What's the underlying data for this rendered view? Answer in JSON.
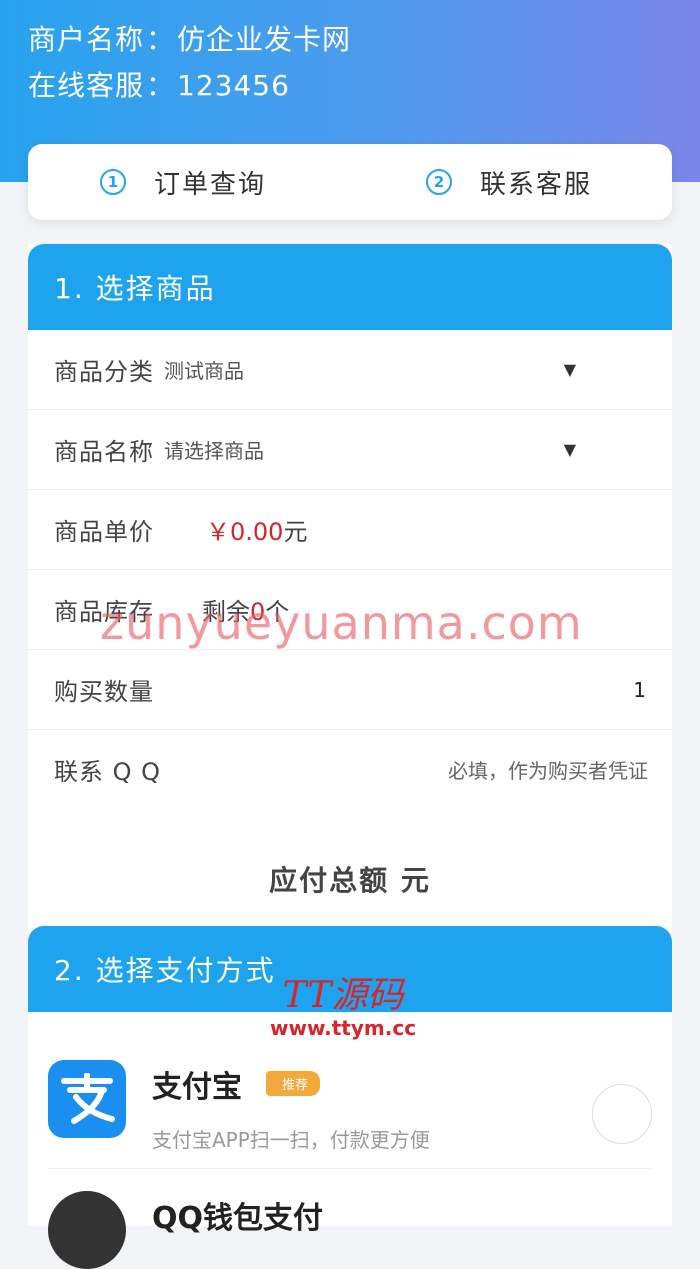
{
  "header": {
    "merchant_label": "商户名称",
    "merchant_name": "仿企业发卡网",
    "service_label": "在线客服",
    "service_value": "123456",
    "separator": "："
  },
  "tabs": [
    {
      "num": "1",
      "label": "订单查询"
    },
    {
      "num": "2",
      "label": "联系客服"
    }
  ],
  "product_section": {
    "title": "1. 选择商品",
    "category_label": "商品分类",
    "category_value": "测试商品",
    "name_label": "商品名称",
    "name_placeholder": "请选择商品",
    "dropdown_glyph": "▼",
    "price_label": "商品单价",
    "price_value": "￥0.00",
    "price_unit": "元",
    "stock_label": "商品库存",
    "stock_prefix": "剩余",
    "stock_count": "0",
    "stock_suffix": "个",
    "quantity_label": "购买数量",
    "quantity_value": "1",
    "qq_label": "联系 Q Q",
    "qq_placeholder": "必填，作为购买者凭证",
    "total_label": "应付总额",
    "total_unit": "元"
  },
  "payment_section": {
    "title": "2. 选择支付方式",
    "methods": [
      {
        "name": "支付宝",
        "badge": "推荐",
        "description": "支付宝APP扫一扫，付款更方便",
        "icon": "alipay-icon",
        "selected": false
      },
      {
        "name": "QQ钱包支付",
        "icon": "qq-wallet-icon"
      }
    ]
  },
  "watermarks": {
    "site": "zunyueyuanma.com",
    "brand": "TT源码",
    "brand_url": "www.ttym.cc"
  },
  "colors": {
    "accent": "#1ea4ee",
    "price": "#d0262d",
    "badge": "#f3a93a",
    "alipay": "#1a8ff0"
  }
}
